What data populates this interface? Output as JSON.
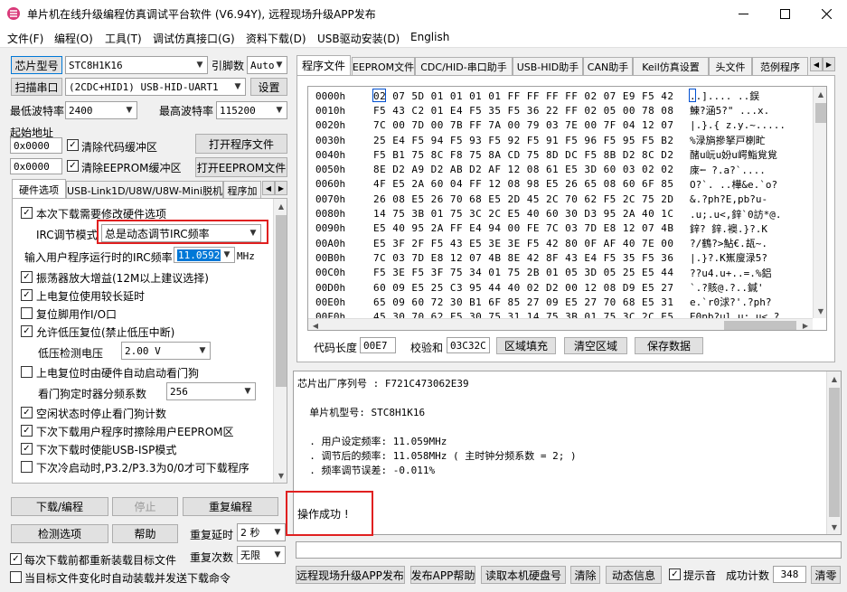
{
  "window": {
    "title": "单片机在线升级编程仿真调试平台软件 (V6.94Y), 远程现场升级APP发布"
  },
  "menu": [
    "文件(F)",
    "编程(O)",
    "工具(T)",
    "调试仿真接口(G)",
    "资料下载(D)",
    "USB驱动安装(D)",
    "English"
  ],
  "left": {
    "chip_button": "芯片型号",
    "chip_value": "STC8H1K16",
    "pin_label": "引脚数",
    "pin_value": "Auto",
    "scan_button": "扫描串口",
    "port_value": "(2CDC+HID1) USB-HID-UART1",
    "settings_button": "设置",
    "min_baud_label": "最低波特率",
    "min_baud_value": "2400",
    "max_baud_label": "最高波特率",
    "max_baud_value": "115200",
    "start_addr_label": "起始地址",
    "code_addr": "0x0000",
    "clear_code_label": "清除代码缓冲区",
    "open_program_button": "打开程序文件",
    "eeprom_addr": "0x0000",
    "clear_eeprom_label": "清除EEPROM缓冲区",
    "open_eeprom_button": "打开EEPROM文件",
    "tabs": [
      "硬件选项",
      "USB-Link1D/U8W/U8W-Mini脱机",
      "程序加"
    ],
    "options": {
      "opt1": "本次下载需要修改硬件选项",
      "irc_mode_label": "IRC调节模式",
      "irc_mode_value": "总是动态调节IRC频率",
      "freq_label": "输入用户程序运行时的IRC频率",
      "freq_value": "11.0592",
      "freq_unit": "MHz",
      "opt2": "振荡器放大增益(12M以上建议选择)",
      "opt3": "上电复位使用较长延时",
      "opt4": "复位脚用作I/O口",
      "opt5": "允许低压复位(禁止低压中断)",
      "lvd_label": "低压检测电压",
      "lvd_value": "2.00 V",
      "opt6": "上电复位时由硬件自动启动看门狗",
      "wdt_label": "看门狗定时器分频系数",
      "wdt_value": "256",
      "opt7": "空闲状态时停止看门狗计数",
      "opt8": "下次下载用户程序时擦除用户EEPROM区",
      "opt9": "下次下载时使能USB-ISP模式",
      "opt10": "下次冷启动时,P3.2/P3.3为0/0才可下载程序"
    },
    "download_button": "下载/编程",
    "stop_button": "停止",
    "reprogram_button": "重复编程",
    "check_button": "检测选项",
    "help_button": "帮助",
    "repeat_delay_label": "重复延时",
    "repeat_delay_value": "2 秒",
    "repeat_count_label": "重复次数",
    "repeat_count_value": "无限",
    "reload_label": "每次下载前都重新装载目标文件",
    "auto_label": "当目标文件变化时自动装载并发送下载命令"
  },
  "right": {
    "tabs": [
      "程序文件",
      "EEPROM文件",
      "CDC/HID-串口助手",
      "USB-HID助手",
      "CAN助手",
      "Keil仿真设置",
      "头文件",
      "范例程序"
    ],
    "hex_rows": [
      {
        "addr": "0000h",
        "bytes": "02 07 5D 01 01 01 01 FF FF FF FF 02 07 E9 F5 42",
        "ascii": "..]....     ..鋘"
      },
      {
        "addr": "0010h",
        "bytes": "F5 43 C2 01 E4 F5 35 F5 36 22 FF 02 05 00 78 08",
        "ascii": "鯟?涵5?\"  ...x."
      },
      {
        "addr": "0020h",
        "bytes": "7C 00 7D 00 7B FF 7A 00 79 03 7E 00 7F 04 12 07",
        "ascii": "|.}.{ z.y.~....."
      },
      {
        "addr": "0030h",
        "bytes": "25 E4 F5 94 F5 93 F5 92 F5 91 F5 96 F5 95 F5 B2",
        "ascii": "%渌旓摻拏戸楋甿"
      },
      {
        "addr": "0040h",
        "bytes": "F5 B1 75 8C F8 75 8A CD 75 8D DC F5 8B D2 8C D2",
        "ascii": "醏u岏u妢u崿鮨覍覍"
      },
      {
        "addr": "0050h",
        "bytes": "8E D2 A9 D2 AB D2 AF 12 08 61 E5 3D 60 03 02 02",
        "ascii": "庲┉ ?.a?`...."
      },
      {
        "addr": "0060h",
        "bytes": "4F E5 2A 60 04 FF 12 08 98 E5 26 65 08 60 6F 85",
        "ascii": "O?`. ..樺&e.`o?"
      },
      {
        "addr": "0070h",
        "bytes": "26 08 E5 26 70 68 E5 2D 45 2C 70 62 F5 2C 75 2D",
        "ascii": "&.?ph?E,pb?u-"
      },
      {
        "addr": "0080h",
        "bytes": "14 75 3B 01 75 3C 2C E5 40 60 30 D3 95 2A 40 1C",
        "ascii": ".u;.u<,鋅`0訪*@."
      },
      {
        "addr": "0090h",
        "bytes": "E5 40 95 2A FF E4 94 00 FE 7C 03 7D E8 12 07 4B",
        "ascii": "鋅?  鋅.襖.}?.K"
      },
      {
        "addr": "00A0h",
        "bytes": "E5 3F 2F F5 43 E5 3E 3E F5 42 80 0F AF 40 7E 00",
        "ascii": "?/鶴?>鮎€.瓳~."
      },
      {
        "addr": "00B0h",
        "bytes": "7C 03 7D E8 12 07 4B 8E 42 8F 43 E4 F5 35 F5 36",
        "ascii": "|.}?.K嶣廋渌5?"
      },
      {
        "addr": "00C0h",
        "bytes": "F5 3E F5 3F 75 34 01 75 2B 01 05 3D 05 25 E5 44",
        "ascii": "??u4.u+..=.%鋁"
      },
      {
        "addr": "00D0h",
        "bytes": "60 09 E5 25 C3 95 44 40 02 D2 00 12 08 D9 E5 27",
        "ascii": "`.?賅@.?..鍼'"
      },
      {
        "addr": "00E0h",
        "bytes": "65 09 60 72 30 B1 6F 85 27 09 E5 27 70 68 E5 31",
        "ascii": "e.`r0浗?'.?ph?"
      },
      {
        "addr": "00F0h",
        "bytes": "45 30 70 62 F5 30 75 31 14 75 3B 01 75 3C 2C E5",
        "ascii": "E0pb?ul.u;.u<,?"
      }
    ],
    "code_len_label": "代码长度",
    "code_len_value": "00E7",
    "checksum_label": "校验和",
    "checksum_value": "03C32C",
    "fill_button": "区域填充",
    "clear_button": "清空区域",
    "save_button": "保存数据",
    "log_lines": [
      "芯片出厂序列号 : F721C473062E39",
      "",
      "  单片机型号: STC8H1K16",
      "",
      "  . 用户设定频率: 11.059MHz",
      "  . 调节后的频率: 11.058MHz ( 主时钟分频系数 = 2; )",
      "  . 频率调节误差: -0.011%"
    ],
    "success_text": "操作成功 !",
    "remote_upgrade_button": "远程现场升级APP发布",
    "app_help_button": "发布APP帮助",
    "read_disk_button": "读取本机硬盘号",
    "clear_log_button": "清除",
    "anim_button": "动态信息",
    "sound_label": "提示音",
    "success_count_label": "成功计数",
    "success_count_value": "348",
    "zero_button": "清零"
  }
}
